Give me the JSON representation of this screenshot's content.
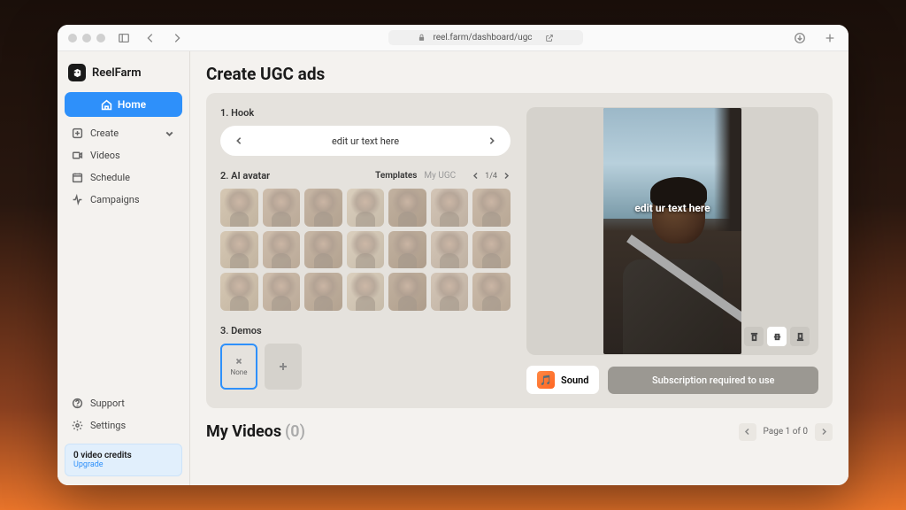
{
  "browser": {
    "url": "reel.farm/dashboard/ugc"
  },
  "brand": {
    "name": "ReelFarm"
  },
  "nav": {
    "home": "Home",
    "items": [
      "Create",
      "Videos",
      "Schedule",
      "Campaigns"
    ],
    "support": "Support",
    "settings": "Settings"
  },
  "credits": {
    "title": "0 video credits",
    "action": "Upgrade"
  },
  "page": {
    "title": "Create UGC ads"
  },
  "steps": {
    "hook": {
      "label": "1. Hook",
      "text": "edit ur text here"
    },
    "avatar": {
      "label": "2. AI avatar",
      "tabs": [
        "Templates",
        "My UGC"
      ],
      "page": "1/4",
      "count": 21
    },
    "demos": {
      "label": "3. Demos",
      "none": "None"
    }
  },
  "preview": {
    "overlay": "edit ur text here",
    "sound": "Sound",
    "subscribe": "Subscription required to use"
  },
  "videos": {
    "title": "My Videos",
    "count": "(0)",
    "pager": "Page 1 of 0"
  }
}
